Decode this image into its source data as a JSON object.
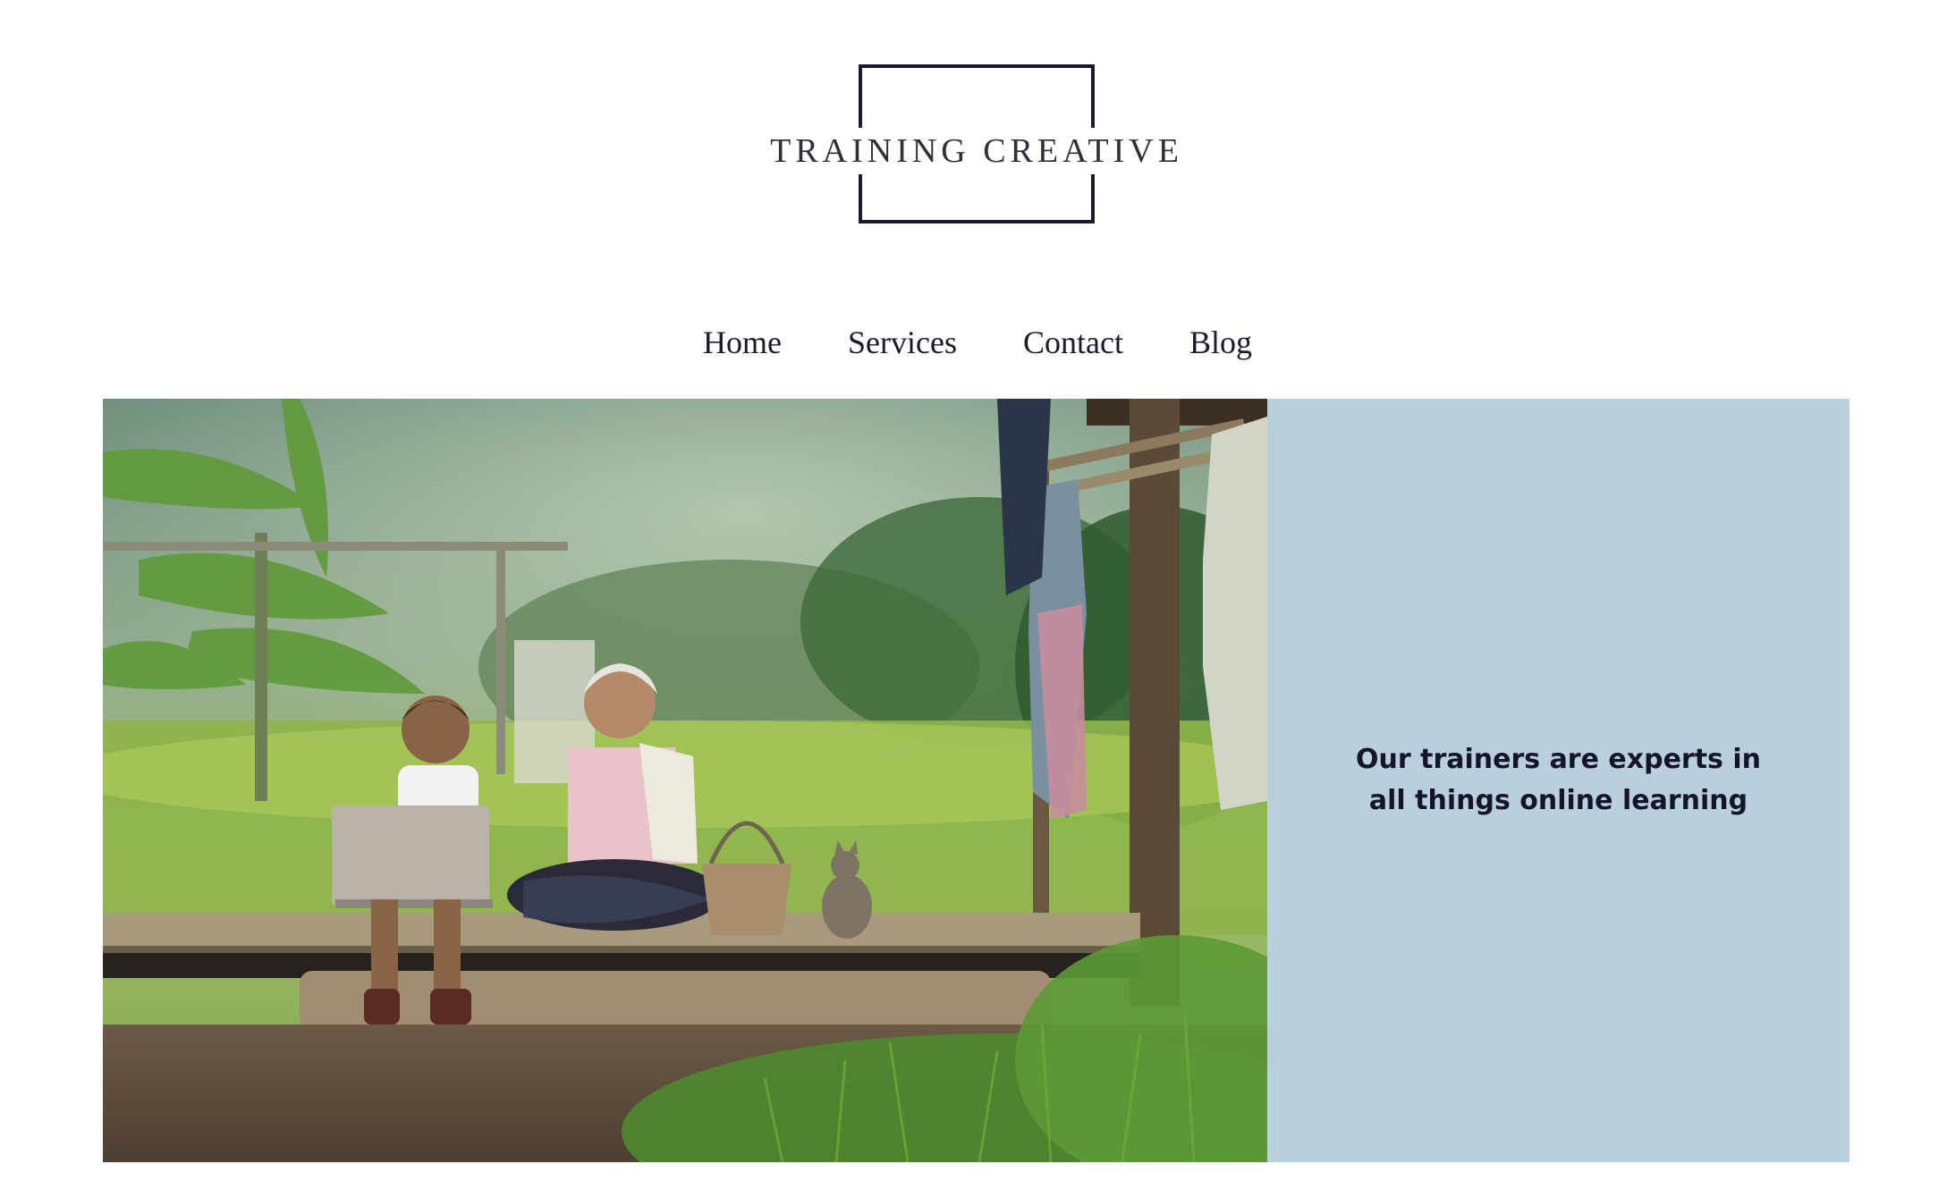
{
  "logo": {
    "text": "TRAINING CREATIVE"
  },
  "nav": {
    "items": [
      {
        "label": "Home"
      },
      {
        "label": "Services"
      },
      {
        "label": "Contact"
      },
      {
        "label": "Blog"
      }
    ]
  },
  "hero": {
    "tagline": "Our trainers are experts in all things online learning",
    "panel_color": "#b9cfdb"
  },
  "colors": {
    "text": "#1b1b2e",
    "background": "#ffffff"
  }
}
